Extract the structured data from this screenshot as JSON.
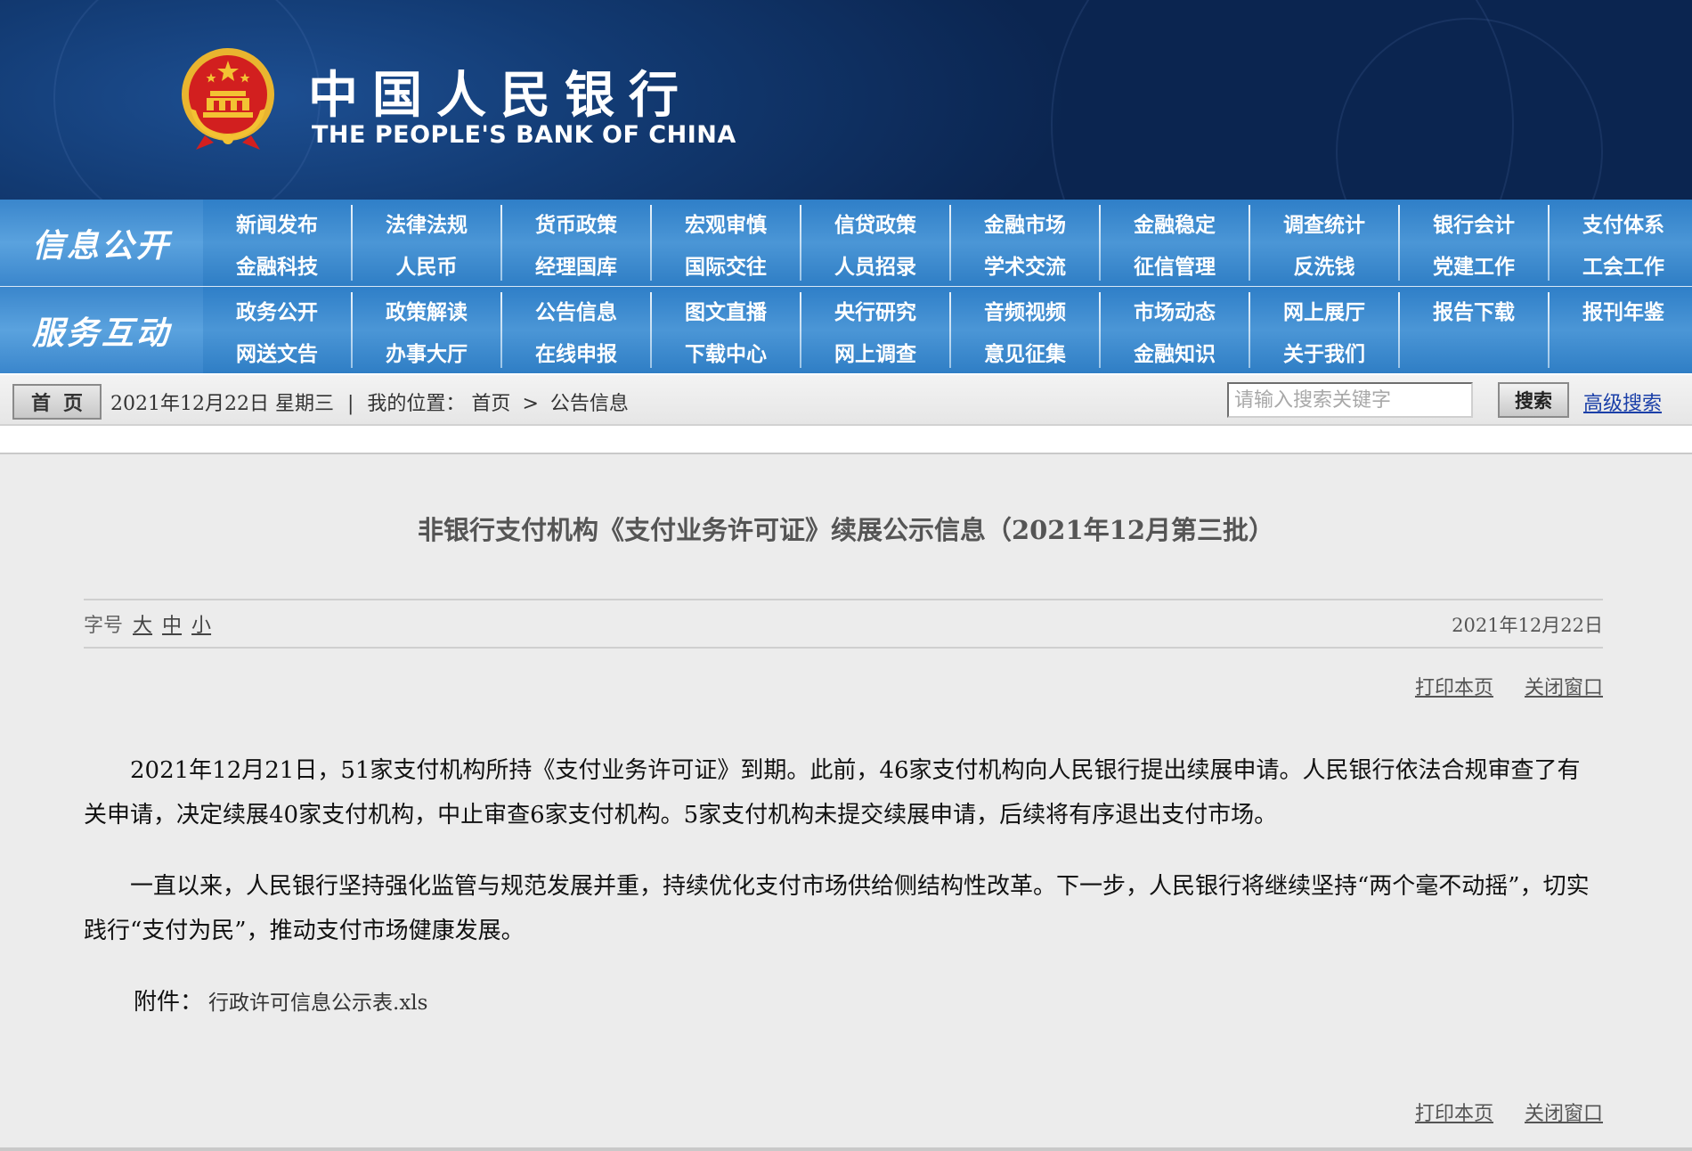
{
  "banner": {
    "title_cn": "中国人民银行",
    "title_en": "THE PEOPLE'S BANK OF CHINA"
  },
  "nav_info": {
    "label": "信息公开",
    "row1": [
      "新闻发布",
      "法律法规",
      "货币政策",
      "宏观审慎",
      "信贷政策",
      "金融市场",
      "金融稳定",
      "调查统计",
      "银行会计",
      "支付体系"
    ],
    "row2": [
      "金融科技",
      "人民币",
      "经理国库",
      "国际交往",
      "人员招录",
      "学术交流",
      "征信管理",
      "反洗钱",
      "党建工作",
      "工会工作"
    ]
  },
  "nav_service": {
    "label": "服务互动",
    "row1": [
      "政务公开",
      "政策解读",
      "公告信息",
      "图文直播",
      "央行研究",
      "音频视频",
      "市场动态",
      "网上展厅",
      "报告下载",
      "报刊年鉴"
    ],
    "row2": [
      "网送文告",
      "办事大厅",
      "在线申报",
      "下载中心",
      "网上调查",
      "意见征集",
      "金融知识",
      "关于我们"
    ]
  },
  "locbar": {
    "home_label": "首页",
    "date_text": "2021年12月22日 星期三",
    "divider": "|",
    "location_prefix": "我的位置：",
    "crumb_home": "首页",
    "crumb_sep": ">",
    "crumb_current": "公告信息",
    "search_placeholder": "请输入搜索关键字",
    "search_button": "搜索",
    "advanced_search": "高级搜索"
  },
  "article": {
    "title": "非银行支付机构《支付业务许可证》续展公示信息（2021年12月第三批）",
    "font_size_label": "字号",
    "font_sizes": [
      "大",
      "中",
      "小"
    ],
    "date": "2021年12月22日",
    "print_label": "打印本页",
    "close_label": "关闭窗口",
    "paragraphs": [
      "2021年12月21日，51家支付机构所持《支付业务许可证》到期。此前，46家支付机构向人民银行提出续展申请。人民银行依法合规审查了有关申请，决定续展40家支付机构，中止审查6家支付机构。5家支付机构未提交续展申请，后续将有序退出支付市场。",
      "一直以来，人民银行坚持强化监管与规范发展并重，持续优化支付市场供给侧结构性改革。下一步，人民银行将继续坚持“两个毫不动摇”，切实践行“支付为民”，推动支付市场健康发展。"
    ],
    "attachment_label": "附件：",
    "attachment_file": "行政许可信息公示表.xls"
  },
  "colors": {
    "banner_dark": "#0b2550",
    "nav_blue": "#3a86cc",
    "link_blue": "#1a3fa8",
    "emblem_red": "#d21f1f",
    "emblem_gold": "#f3c233"
  }
}
